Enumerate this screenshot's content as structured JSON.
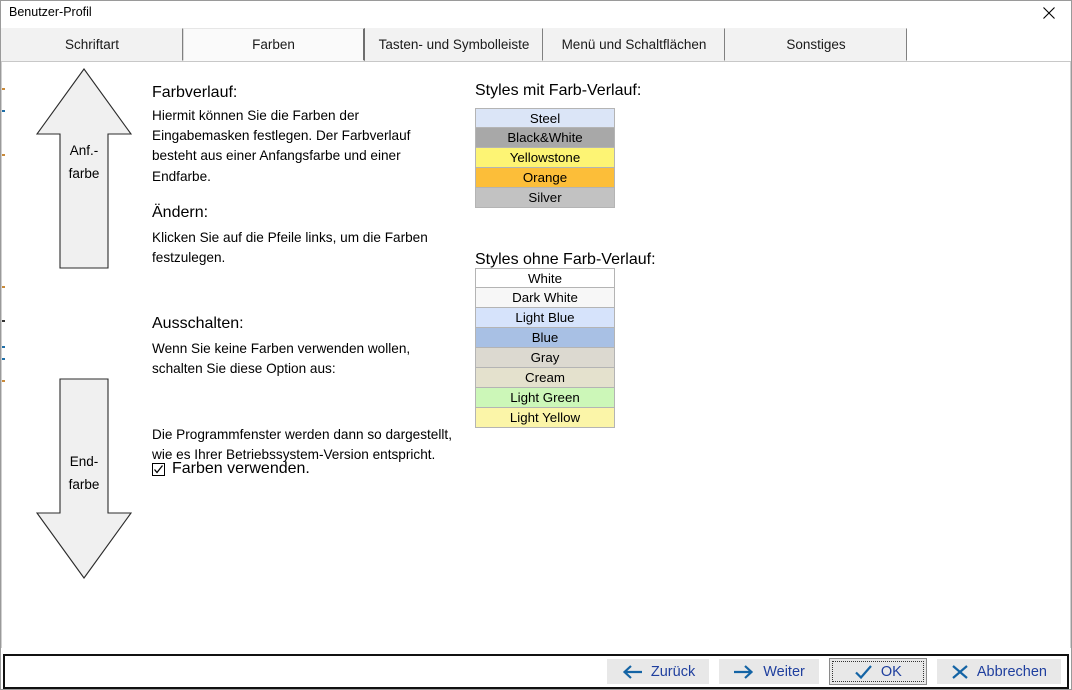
{
  "window": {
    "title": "Benutzer-Profil",
    "close_icon": "close-icon"
  },
  "tabs": [
    {
      "label": "Schriftart",
      "selected": false
    },
    {
      "label": "Farben",
      "selected": true
    },
    {
      "label": "Tasten- und Symbolleiste",
      "selected": false
    },
    {
      "label": "Menü und Schaltflächen",
      "selected": false
    },
    {
      "label": "Sonstiges",
      "selected": false
    }
  ],
  "arrows": {
    "start": {
      "label_line1": "Anf.-",
      "label_line2": "farbe",
      "direction": "up"
    },
    "end": {
      "label_line1": "End-",
      "label_line2": "farbe",
      "direction": "down"
    }
  },
  "sections": {
    "gradient": {
      "heading": "Farbverlauf:",
      "body": "Hiermit können Sie die Farben der Eingabemasken festlegen. Der Farbverlauf besteht aus einer Anfangsfarbe und einer Endfarbe."
    },
    "change": {
      "heading": "Ändern:",
      "body": "Klicken Sie auf die Pfeile links, um die Farben festzulegen."
    },
    "disable": {
      "heading": "Ausschalten:",
      "body": "Wenn Sie keine Farben verwenden wollen, schalten Sie diese Option aus:",
      "checkbox_label": "Farben verwenden.",
      "checkbox_checked": true,
      "footer": "Die Programmfenster werden dann so dargestellt, wie es Ihrer Betriebssystem-Version entspricht."
    }
  },
  "styles_with_gradient": {
    "title": "Styles mit Farb-Verlauf:",
    "items": [
      {
        "label": "Steel",
        "bg": "#dbe5f7"
      },
      {
        "label": "Black&White",
        "bg": "#a8a8a8"
      },
      {
        "label": "Yellowstone",
        "bg": "#fdf474"
      },
      {
        "label": "Orange",
        "bg": "#fcbe39"
      },
      {
        "label": "Silver",
        "bg": "#c2c2c2"
      }
    ]
  },
  "styles_without_gradient": {
    "title": "Styles ohne Farb-Verlauf:",
    "items": [
      {
        "label": "White",
        "bg": "#ffffff"
      },
      {
        "label": "Dark White",
        "bg": "#f7f7f7"
      },
      {
        "label": "Light Blue",
        "bg": "#d6e3fb"
      },
      {
        "label": "Blue",
        "bg": "#a8c0e4"
      },
      {
        "label": "Gray",
        "bg": "#dcd9d0"
      },
      {
        "label": "Cream",
        "bg": "#e4e1cd"
      },
      {
        "label": "Light Green",
        "bg": "#ccf7b8"
      },
      {
        "label": "Light Yellow",
        "bg": "#fbf5a8"
      }
    ]
  },
  "buttons": [
    {
      "label": "Zurück",
      "icon": "arrow-left-icon",
      "kind": "plain"
    },
    {
      "label": "Weiter",
      "icon": "arrow-right-icon",
      "kind": "plain"
    },
    {
      "label": "OK",
      "icon": "check-icon",
      "kind": "default"
    },
    {
      "label": "Abbrechen",
      "icon": "cross-icon",
      "kind": "plain"
    }
  ],
  "colors": {
    "accent_blue": "#1f3f9e",
    "icon_blue": "#1464a5",
    "tab_bg": "#f2f2f2",
    "tab_selected_bg": "#fafafa",
    "arrow_fill": "#f0f0f0"
  }
}
